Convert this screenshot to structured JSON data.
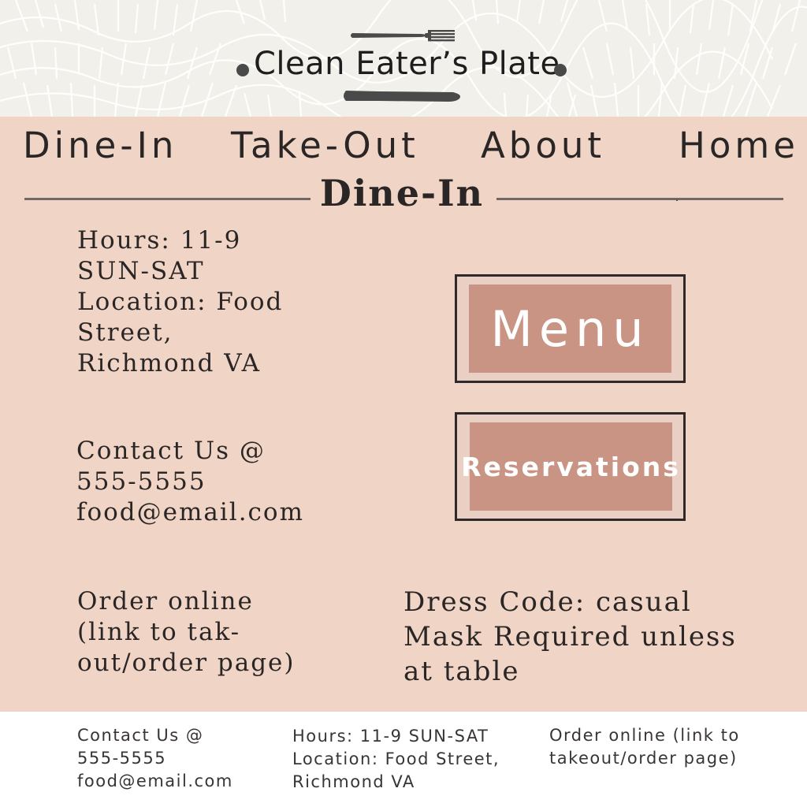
{
  "brand": {
    "name": "Clean Eater’s Plate",
    "icons": [
      "fork-icon",
      "knife-icon"
    ],
    "colors": {
      "icon": "#4b4a4a",
      "header_bg": "#f2f0ea"
    }
  },
  "nav": {
    "items": [
      {
        "label": "Dine-In"
      },
      {
        "label": "Take-Out"
      },
      {
        "label": "About"
      },
      {
        "label": "Home"
      }
    ]
  },
  "page": {
    "title": "Dine-In",
    "background": "#f0d5c6"
  },
  "info": {
    "hours_lines": [
      "Hours: 11-9",
      "SUN-SAT",
      "Location: Food",
      "Street,",
      "Richmond VA"
    ],
    "contact_lines": [
      "Contact Us @",
      "555-5555",
      "food@email.com"
    ],
    "order_lines": [
      "Order online",
      "(link to tak-",
      "out/order page)"
    ],
    "dress_lines": [
      "Dress Code: casual",
      "Mask Required unless",
      "at table"
    ]
  },
  "buttons": {
    "menu_label": "Menu",
    "reservations_label": "Reservations",
    "fill_color": "#c99484"
  },
  "footer": {
    "contact_lines": [
      "Contact Us @",
      "555-5555",
      "food@email.com"
    ],
    "hours_lines": [
      "Hours: 11-9 SUN-SAT",
      "Location: Food Street,",
      "Richmond VA"
    ],
    "order_lines": [
      "Order online (link to",
      "takeout/order page)"
    ]
  }
}
